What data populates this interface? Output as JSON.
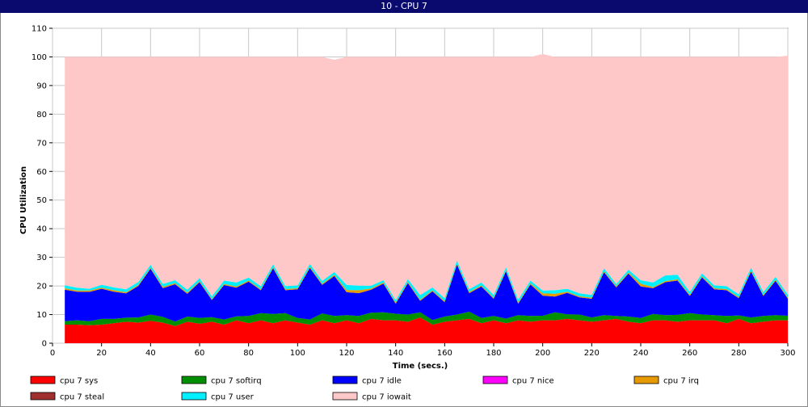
{
  "window": {
    "title": "10 - CPU 7"
  },
  "chart_data": {
    "type": "area",
    "stacked": true,
    "title": "",
    "xlabel": "Time (secs.)",
    "ylabel": "CPU Utilization",
    "xlim": [
      0,
      300
    ],
    "ylim": [
      0,
      110
    ],
    "x_ticks": [
      "0",
      "20",
      "40",
      "60",
      "80",
      "100",
      "120",
      "140",
      "160",
      "180",
      "200",
      "220",
      "240",
      "260",
      "280",
      "300"
    ],
    "y_ticks": [
      "0",
      "10",
      "20",
      "30",
      "40",
      "50",
      "60",
      "70",
      "80",
      "90",
      "100",
      "110"
    ],
    "grid": true,
    "legend_position": "bottom",
    "x": [
      5,
      10,
      15,
      20,
      25,
      30,
      35,
      40,
      45,
      50,
      55,
      60,
      65,
      70,
      75,
      80,
      85,
      90,
      95,
      100,
      105,
      110,
      115,
      120,
      125,
      130,
      135,
      140,
      145,
      150,
      155,
      160,
      165,
      170,
      175,
      180,
      185,
      190,
      195,
      200,
      205,
      210,
      215,
      220,
      225,
      230,
      235,
      240,
      245,
      250,
      255,
      260,
      265,
      270,
      275,
      280,
      285,
      290,
      295,
      300
    ],
    "series": [
      {
        "name": "cpu 7 sys",
        "color": "#ff0000",
        "values": [
          6.5,
          6.5,
          6.3,
          6.5,
          7,
          7.5,
          7.2,
          7.8,
          7.2,
          6,
          7.5,
          6.8,
          7.5,
          6.5,
          8,
          7,
          8,
          7,
          8,
          7.2,
          6.5,
          8,
          7,
          8,
          7,
          8.5,
          8,
          8,
          7.5,
          9,
          6.5,
          7.5,
          8,
          8.5,
          7,
          8,
          7,
          8,
          7.5,
          8,
          8,
          8.5,
          8,
          7.5,
          8,
          8.5,
          7.5,
          7,
          8,
          8,
          7.5,
          8,
          8,
          8,
          7,
          8.5,
          7,
          7.5,
          8,
          8
        ]
      },
      {
        "name": "cpu 7 softirq",
        "color": "#008f00",
        "values": [
          1.2,
          1.5,
          1.4,
          2,
          1.5,
          1.4,
          1.8,
          2.2,
          2,
          1.6,
          1.8,
          2,
          1.6,
          1.8,
          1.4,
          2.5,
          2.5,
          3.2,
          2.5,
          1.6,
          1.8,
          2.4,
          2.5,
          1.8,
          2.5,
          2.2,
          2.8,
          2.3,
          2.5,
          1.8,
          1.6,
          1.8,
          2,
          2.5,
          1.8,
          1.5,
          1.6,
          1.8,
          2,
          1.6,
          2.8,
          1.6,
          2,
          1.5,
          1.8,
          1,
          1.8,
          1.8,
          2.2,
          1.8,
          2.4,
          2.5,
          2,
          1.8,
          2.5,
          1.2,
          2,
          2,
          1.8,
          1.6
        ]
      },
      {
        "name": "cpu 7 idle",
        "color": "#0000ff",
        "values": [
          11,
          10,
          10.2,
          10.5,
          9.5,
          8.5,
          11,
          16,
          10,
          13,
          8,
          12.5,
          6,
          12,
          10,
          12,
          8,
          16,
          8,
          10,
          18,
          10,
          14,
          8,
          8,
          8,
          10,
          3.5,
          11,
          4,
          10,
          5,
          17.5,
          6.5,
          11,
          6,
          16.5,
          4,
          11,
          7,
          5.5,
          7.5,
          6,
          6.5,
          15,
          10,
          15,
          11,
          9,
          11.5,
          12,
          6,
          13,
          9,
          9,
          6,
          16,
          7,
          12,
          6
        ]
      },
      {
        "name": "cpu 7 nice",
        "color": "#ff00ff",
        "values": [
          0,
          0,
          0,
          0,
          0,
          0,
          0,
          0,
          0,
          0,
          0,
          0,
          0,
          0,
          0,
          0,
          0,
          0,
          0,
          0,
          0,
          0,
          0,
          0,
          0,
          0,
          0,
          0,
          0,
          0,
          0,
          0,
          0,
          0,
          0,
          0,
          0,
          0,
          0,
          0,
          0,
          0,
          0,
          0,
          0,
          0,
          0,
          0,
          0,
          0,
          0,
          0,
          0,
          0,
          0,
          0,
          0,
          0,
          0,
          0
        ]
      },
      {
        "name": "cpu 7 irq",
        "color": "#e69a00",
        "values": [
          0.5,
          0.4,
          0.5,
          0.4,
          0.5,
          0.4,
          0.4,
          0.4,
          0.5,
          0.4,
          0.4,
          0.4,
          0.3,
          0.4,
          0.4,
          0.4,
          0.4,
          0.4,
          0.4,
          0.4,
          0.4,
          0.4,
          0.4,
          0.8,
          1,
          0.4,
          0.4,
          0.4,
          0.4,
          0.4,
          0.4,
          0.4,
          0.4,
          0.4,
          0.4,
          0.4,
          0.4,
          0.4,
          0.4,
          0.8,
          1,
          0.4,
          0.4,
          0.4,
          0.4,
          0.4,
          0.4,
          1,
          0.4,
          0.4,
          0.4,
          0.4,
          0.4,
          0.4,
          0.4,
          0.4,
          0.4,
          0.4,
          0.4,
          0.4
        ]
      },
      {
        "name": "cpu 7 steal",
        "color": "#a03030",
        "values": [
          0,
          0,
          0,
          0,
          0,
          0,
          0,
          0,
          0,
          0,
          0,
          0,
          0,
          0,
          0,
          0,
          0,
          0,
          0,
          0,
          0,
          0,
          0,
          0,
          0,
          0,
          0,
          0,
          0,
          0,
          0,
          0,
          0,
          0,
          0,
          0,
          0,
          0,
          0,
          0,
          0,
          0,
          0,
          0,
          0,
          0,
          0,
          0,
          0,
          0,
          0,
          0,
          0,
          0,
          0,
          0,
          0,
          0,
          0,
          0
        ]
      },
      {
        "name": "cpu 7 user",
        "color": "#00f0ff",
        "values": [
          1,
          1,
          0.6,
          1,
          1,
          1,
          1,
          1,
          1,
          1,
          1,
          1,
          1,
          1.2,
          1.4,
          1,
          1,
          1,
          1,
          1,
          1,
          1,
          1,
          1.8,
          1.6,
          1,
          0.8,
          0.8,
          1,
          1.6,
          1,
          1,
          1,
          1,
          1,
          1,
          1,
          1,
          1,
          1,
          1.2,
          1,
          1,
          1,
          1,
          0.8,
          1,
          1.2,
          1.6,
          2,
          1.6,
          1,
          1,
          1,
          1,
          1,
          1,
          1,
          1,
          1
        ]
      },
      {
        "name": "cpu 7 iowait",
        "color": "#ffc8c8",
        "values": [
          79.8,
          80.6,
          81,
          79.6,
          80.5,
          81.2,
          78.6,
          72.6,
          79.3,
          78,
          81.3,
          77.3,
          83.6,
          78.1,
          78.8,
          77.1,
          80.1,
          72.4,
          80.1,
          79.8,
          72.3,
          78.2,
          74.1,
          79.6,
          79.9,
          79.9,
          78,
          85,
          77.6,
          83.2,
          80.5,
          84.3,
          71.1,
          81.1,
          78.8,
          83.1,
          73.5,
          84.8,
          78.1,
          82.6,
          81.5,
          81,
          82.6,
          83.1,
          73.8,
          79.3,
          74.3,
          78,
          78.8,
          76.3,
          76.1,
          82.1,
          75.6,
          79.8,
          80.1,
          82.9,
          73.6,
          82.1,
          76.8,
          83.4
        ]
      }
    ]
  }
}
